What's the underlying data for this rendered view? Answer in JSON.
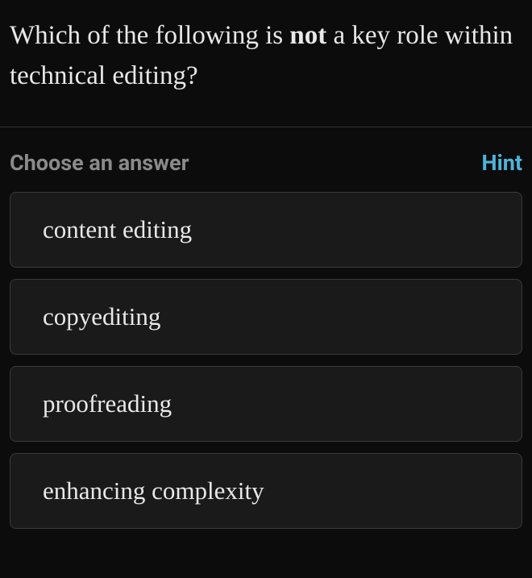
{
  "question": {
    "prefix": "Which of the following is ",
    "emphasis": "not",
    "suffix": " a key role within technical editing?"
  },
  "answer_header": {
    "choose_label": "Choose an answer",
    "hint_label": "Hint"
  },
  "options": [
    {
      "label": "content editing"
    },
    {
      "label": "copyediting"
    },
    {
      "label": "proofreading"
    },
    {
      "label": "enhancing complexity"
    }
  ]
}
